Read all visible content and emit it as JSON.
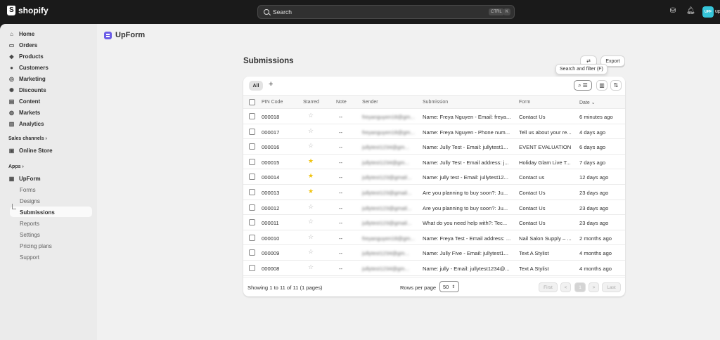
{
  "topbar": {
    "brand": "shopify",
    "search_placeholder": "Search",
    "kbd_ctrl": "CTRL",
    "kbd_k": "K",
    "avatar_initials": "UPF",
    "avatar_name": "up"
  },
  "sidebar": {
    "items": [
      {
        "label": "Home",
        "icon": "home-icon"
      },
      {
        "label": "Orders",
        "icon": "inbox-icon"
      },
      {
        "label": "Products",
        "icon": "tag-icon"
      },
      {
        "label": "Customers",
        "icon": "person-icon"
      },
      {
        "label": "Marketing",
        "icon": "target-icon"
      },
      {
        "label": "Discounts",
        "icon": "discount-icon"
      },
      {
        "label": "Content",
        "icon": "content-icon"
      },
      {
        "label": "Markets",
        "icon": "globe-icon"
      },
      {
        "label": "Analytics",
        "icon": "bar-chart-icon"
      }
    ],
    "sales_channels_label": "Sales channels",
    "online_store_label": "Online Store",
    "apps_label": "Apps",
    "upform_label": "UpForm",
    "sub_items": [
      "Forms",
      "Designs",
      "Submissions",
      "Reports",
      "Settings",
      "Pricing plans",
      "Support"
    ]
  },
  "app": {
    "name": "UpForm",
    "page_title": "Submissions",
    "export_label": "Export",
    "tooltip": "Search and filter (F)",
    "tab_all": "All",
    "tab_add": "+"
  },
  "table": {
    "headers": [
      "PIN Code",
      "Starred",
      "Note",
      "Sender",
      "Submission",
      "Form",
      "Date"
    ],
    "rows": [
      {
        "pin": "000018",
        "starred": false,
        "note": "--",
        "sender": "freyanguyen18@gm...",
        "submission": "Name: Freya Nguyen - Email: freya...",
        "form": "Contact Us",
        "date": "6 minutes ago"
      },
      {
        "pin": "000017",
        "starred": false,
        "note": "--",
        "sender": "freyanguyen18@gm...",
        "submission": "Name: Freya Nguyen - Phone num...",
        "form": "Tell us about your re...",
        "date": "4 days ago"
      },
      {
        "pin": "000016",
        "starred": false,
        "note": "--",
        "sender": "jullytest1234@gm...",
        "submission": "Name: Jully Test - Email: jullytest1...",
        "form": "EVENT EVALUATION",
        "date": "6 days ago"
      },
      {
        "pin": "000015",
        "starred": true,
        "note": "--",
        "sender": "jullytest1234@gm...",
        "submission": "Name: Jully Test - Email address: j...",
        "form": "Holiday Glam Live T...",
        "date": "7 days ago"
      },
      {
        "pin": "000014",
        "starred": true,
        "note": "--",
        "sender": "jullytest123@gmail...",
        "submission": "Name: jully test - Email: jullytest12...",
        "form": "Contact us",
        "date": "12 days ago"
      },
      {
        "pin": "000013",
        "starred": true,
        "note": "--",
        "sender": "jullytest123@gmail...",
        "submission": "Are you planning to buy soon?: Ju...",
        "form": "Contact Us",
        "date": "23 days ago"
      },
      {
        "pin": "000012",
        "starred": false,
        "note": "--",
        "sender": "jullytest123@gmail...",
        "submission": "Are you planning to buy soon?: Ju...",
        "form": "Contact Us",
        "date": "23 days ago"
      },
      {
        "pin": "000011",
        "starred": false,
        "note": "--",
        "sender": "jullytest123@gmail...",
        "submission": "What do you need help with?: Tec...",
        "form": "Contact Us",
        "date": "23 days ago"
      },
      {
        "pin": "000010",
        "starred": false,
        "note": "--",
        "sender": "freyanguyen18@gm...",
        "submission": "Name: Freya Test - Email address: ...",
        "form": "Nail Salon Supply – ...",
        "date": "2 months ago"
      },
      {
        "pin": "000009",
        "starred": false,
        "note": "--",
        "sender": "jullytest1234@gm...",
        "submission": "Name: Jully Five - Email: jullytest1...",
        "form": "Text A Stylist",
        "date": "4 months ago"
      },
      {
        "pin": "000008",
        "starred": false,
        "note": "--",
        "sender": "jullytest1234@gm...",
        "submission": "Name: jully - Email: jullytest1234@...",
        "form": "Text A Stylist",
        "date": "4 months ago"
      }
    ]
  },
  "footer": {
    "showing": "Showing 1 to 11 of 11 (1 pages)",
    "rows_per_page_label": "Rows per page",
    "rows_per_page_value": "50",
    "first": "First",
    "prev": "<",
    "page": "1",
    "next": ">",
    "last": "Last"
  },
  "colors": {
    "topbar": "#1a1a1a",
    "star_on": "#f0c30f",
    "arrow": "#e0201f",
    "app_logo": "#6b5ce7",
    "avatar": "#36c5d9"
  }
}
